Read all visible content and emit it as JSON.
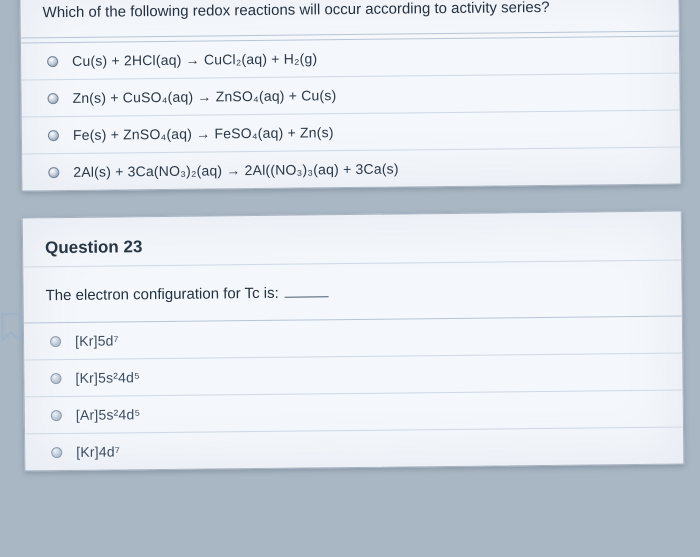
{
  "q1": {
    "prompt": "Which of the following redox reactions will occur according to activity series?",
    "options": [
      "Cu(s) + 2HCl(aq) → CuCl₂(aq) + H₂(g)",
      "Zn(s) + CuSO₄(aq) → ZnSO₄(aq) + Cu(s)",
      "Fe(s) + ZnSO₄(aq) → FeSO₄(aq) + Zn(s)",
      "2Al(s) + 3Ca(NO₃)₂(aq) → 2Al((NO₃)₃(aq) + 3Ca(s)"
    ]
  },
  "q2": {
    "number_label": "Question 23",
    "prompt": "The electron configuration for Tc is:",
    "options": [
      "[Kr]5d⁷",
      "[Kr]5s²4d⁵",
      "[Ar]5s²4d⁵",
      "[Kr]4d⁷"
    ]
  }
}
